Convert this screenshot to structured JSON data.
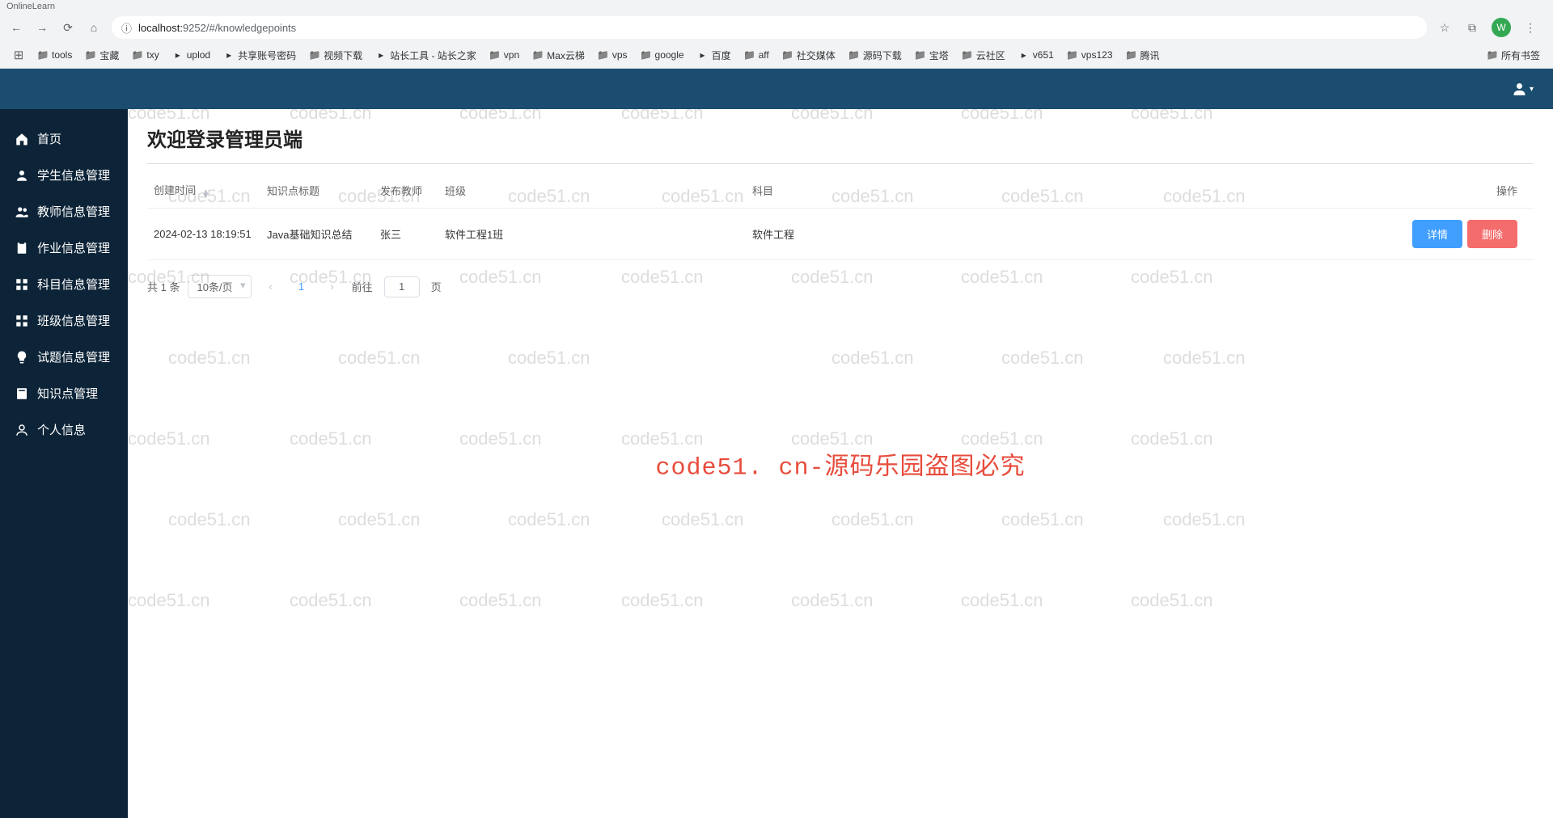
{
  "browser": {
    "tab_title": "OnlineLearn",
    "url_host": "localhost:",
    "url_port_path": "9252/#/knowledgepoints",
    "avatar_letter": "W"
  },
  "bookmarks": [
    {
      "label": "tools",
      "type": "folder"
    },
    {
      "label": "宝藏",
      "type": "folder"
    },
    {
      "label": "txy",
      "type": "folder"
    },
    {
      "label": "uplod",
      "type": "link"
    },
    {
      "label": "共享账号密码",
      "type": "link"
    },
    {
      "label": "视频下载",
      "type": "folder"
    },
    {
      "label": "站长工具 - 站长之家",
      "type": "link"
    },
    {
      "label": "vpn",
      "type": "folder"
    },
    {
      "label": "Max云梯",
      "type": "folder"
    },
    {
      "label": "vps",
      "type": "folder"
    },
    {
      "label": "google",
      "type": "folder"
    },
    {
      "label": "百度",
      "type": "link"
    },
    {
      "label": "aff",
      "type": "folder"
    },
    {
      "label": "社交媒体",
      "type": "folder"
    },
    {
      "label": "源码下载",
      "type": "folder"
    },
    {
      "label": "宝塔",
      "type": "folder"
    },
    {
      "label": "云社区",
      "type": "folder"
    },
    {
      "label": "v651",
      "type": "link"
    },
    {
      "label": "vps123",
      "type": "folder"
    },
    {
      "label": "腾讯",
      "type": "folder"
    }
  ],
  "bookmarks_overflow": "所有书签",
  "sidebar": {
    "items": [
      {
        "icon": "home",
        "label": "首页"
      },
      {
        "icon": "user",
        "label": "学生信息管理"
      },
      {
        "icon": "users",
        "label": "教师信息管理"
      },
      {
        "icon": "clipboard",
        "label": "作业信息管理"
      },
      {
        "icon": "grid",
        "label": "科目信息管理"
      },
      {
        "icon": "grid",
        "label": "班级信息管理"
      },
      {
        "icon": "lightbulb",
        "label": "试题信息管理"
      },
      {
        "icon": "book",
        "label": "知识点管理"
      },
      {
        "icon": "person",
        "label": "个人信息"
      }
    ]
  },
  "page": {
    "title": "欢迎登录管理员端"
  },
  "table": {
    "headers": {
      "created_at": "创建时间",
      "title": "知识点标题",
      "teacher": "发布教师",
      "class": "班级",
      "subject": "科目",
      "actions": "操作"
    },
    "rows": [
      {
        "created_at": "2024-02-13 18:19:51",
        "title": "Java基础知识总结",
        "teacher": "张三",
        "class": "软件工程1班",
        "subject": "软件工程"
      }
    ],
    "actions": {
      "detail": "详情",
      "delete": "删除"
    }
  },
  "pagination": {
    "total_text": "共 1 条",
    "page_size": "10条/页",
    "current": "1",
    "goto_prefix": "前往",
    "goto_value": "1",
    "goto_suffix": "页"
  },
  "watermark": {
    "center": "code51. cn-源码乐园盗图必究",
    "faint": "code51.cn"
  }
}
